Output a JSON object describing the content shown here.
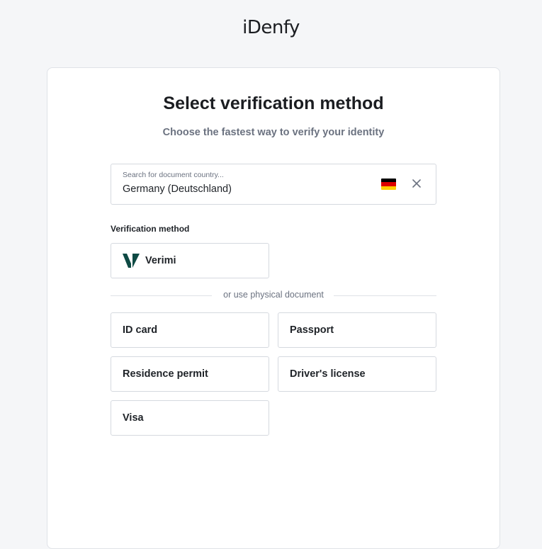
{
  "header": {
    "logo_text": "iDenfy"
  },
  "main": {
    "title": "Select verification method",
    "subtitle": "Choose the fastest way to verify your identity",
    "search": {
      "placeholder": "Search for document country...",
      "value": "Germany (Deutschland)",
      "flag_colors": [
        "#000000",
        "#dd0000",
        "#ffce00"
      ]
    },
    "verification_method_label": "Verification method",
    "verimi_label": "Verimi",
    "divider_text": "or use physical document",
    "documents": {
      "id_card": "ID card",
      "passport": "Passport",
      "residence_permit": "Residence permit",
      "drivers_license": "Driver's license",
      "visa": "Visa"
    }
  },
  "colors": {
    "background": "#f5f6f8",
    "card": "#ffffff",
    "border": "#d5d9df",
    "muted_text": "#6b7280",
    "verimi_brand": "#0e4a44"
  }
}
